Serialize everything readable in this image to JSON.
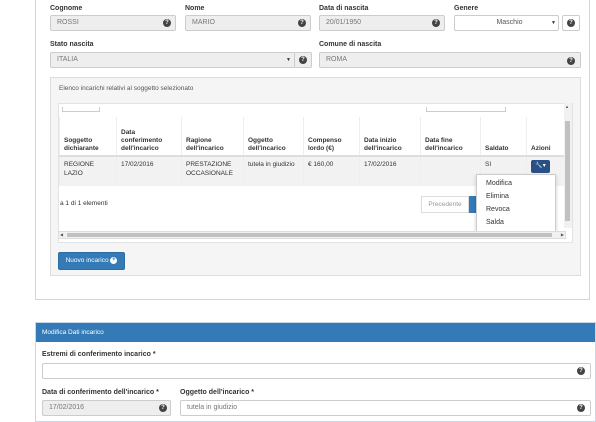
{
  "personal": {
    "cognome_label": "Cognome",
    "cognome_value": "ROSSI",
    "nome_label": "Nome",
    "nome_value": "MARIO",
    "data_nascita_label": "Data di nascita",
    "data_nascita_value": "20/01/1950",
    "genere_label": "Genere",
    "genere_value": "Maschio",
    "stato_nascita_label": "Stato nascita",
    "stato_nascita_value": "ITALIA",
    "comune_nascita_label": "Comune di nascita",
    "comune_nascita_value": "ROMA"
  },
  "incarichi": {
    "panel_title": "Elenco incarichi relativi al soggetto selezionato",
    "columns": [
      "Soggetto dichiarante",
      "Data conferimento dell'incarico",
      "Ragione dell'incarico",
      "Oggetto dell'incarico",
      "Compenso lordo (€)",
      "Data inizio dell'incarico",
      "Data fine dell'incarico",
      "Saldato",
      "Azioni"
    ],
    "rows": [
      {
        "soggetto": "REGIONE LAZIO",
        "data_conferimento": "17/02/2016",
        "ragione": "PRESTAZIONE OCCASIONALE",
        "oggetto": "tutela in giudizio",
        "compenso": "€ 160,00",
        "data_inizio": "17/02/2016",
        "data_fine": "",
        "saldato": "SI"
      }
    ],
    "actions_menu": [
      "Modifica",
      "Elimina",
      "Revoca",
      "Salda"
    ],
    "pager_text": "a 1 di 1 elementi",
    "prev_label": "Precedente",
    "new_button": "Nuovo incarico"
  },
  "modifica": {
    "header": "Modifica Dati incarico",
    "estremi_label": "Estremi di conferimento incarico *",
    "estremi_value": "",
    "data_conf_label": "Data di conferimento dell'incarico *",
    "data_conf_value": "17/02/2016",
    "oggetto_label": "Oggetto dell'incarico *",
    "oggetto_value": "tutela in giudizio"
  },
  "icons": {
    "help": "question-circle-icon",
    "wrench": "wrench-icon",
    "plus": "plus-circle-icon"
  },
  "colors": {
    "primary": "#337ab7",
    "action_button": "#2a4f86"
  }
}
